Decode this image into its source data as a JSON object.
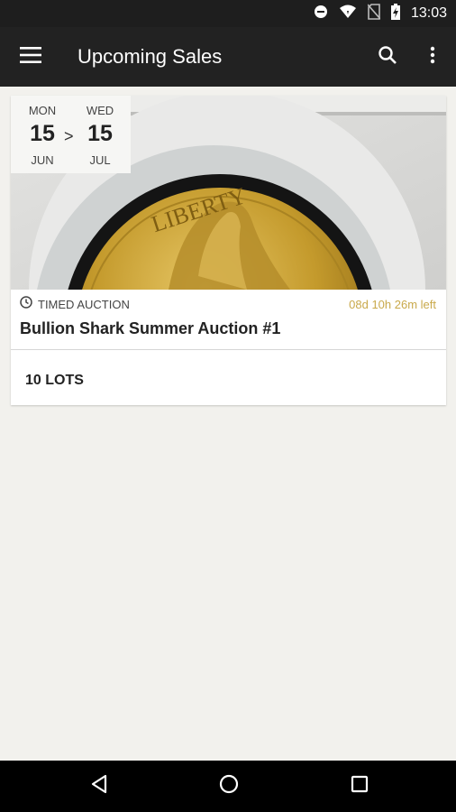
{
  "status_bar": {
    "time": "13:03",
    "icons": [
      "do-not-disturb-icon",
      "wifi-icon",
      "no-sim-icon",
      "battery-charging-icon"
    ]
  },
  "app_bar": {
    "title": "Upcoming Sales",
    "icons": [
      "menu-icon",
      "search-icon",
      "more-vert-icon"
    ]
  },
  "sale": {
    "start": {
      "weekday": "MON",
      "day": "15",
      "month": "JUN"
    },
    "separator": ">",
    "end": {
      "weekday": "WED",
      "day": "15",
      "month": "JUL"
    },
    "type": "TIMED AUCTION",
    "time_left": "08d 10h 26m left",
    "title": "Bullion Shark Summer Auction #1",
    "lots": "10 LOTS"
  },
  "nav_bar": {
    "icons": [
      "back-icon",
      "home-icon",
      "recents-icon"
    ]
  },
  "colors": {
    "app_bar": "#222222",
    "background": "#f2f1ed",
    "time_left": "#c9a94b",
    "gold": "#c9a23a"
  }
}
